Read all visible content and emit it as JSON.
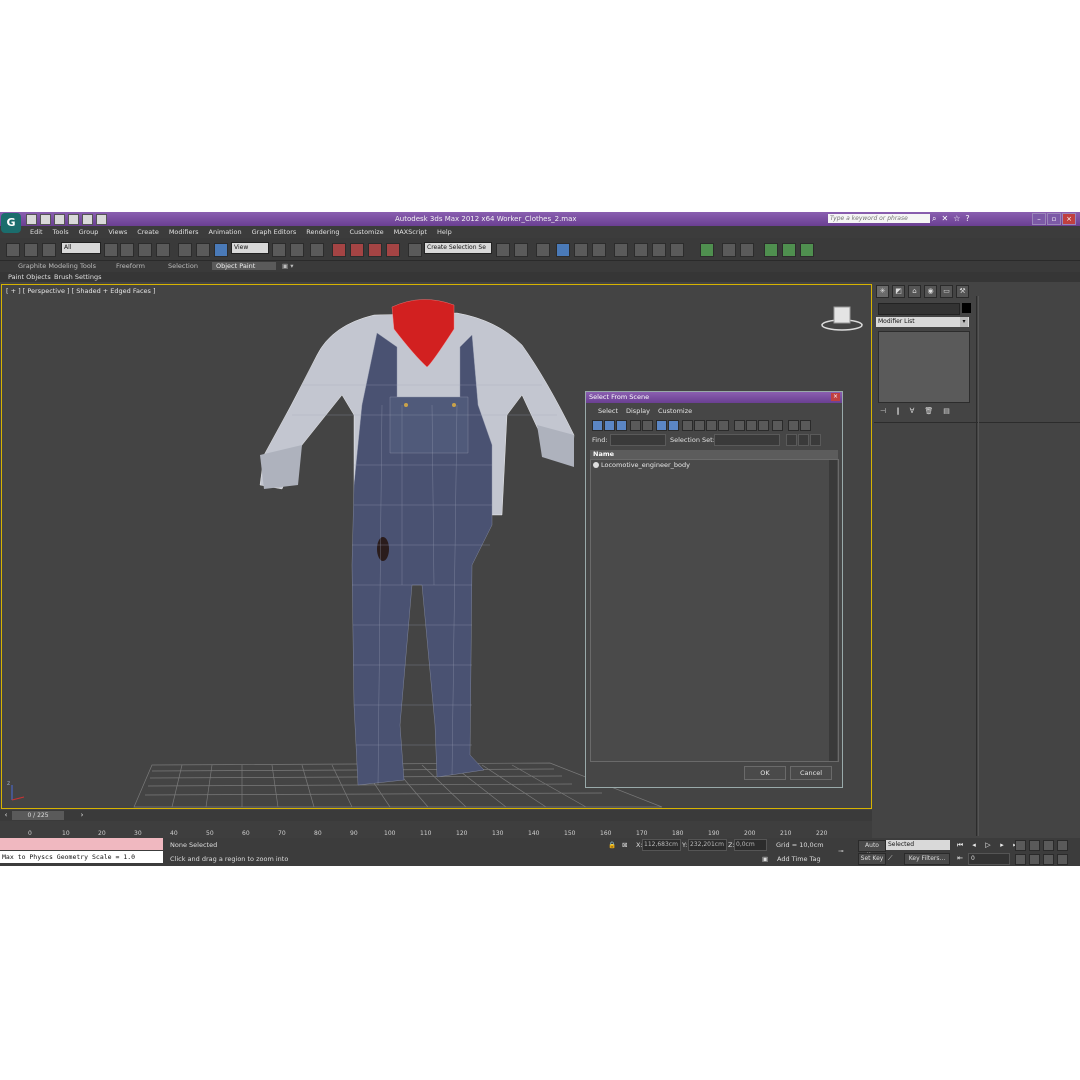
{
  "title_bar": {
    "app_title": "Autodesk 3ds Max  2012 x64     Worker_Clothes_2.max",
    "logo_text": "G",
    "search_placeholder": "Type a keyword or phrase",
    "help_icon": "?"
  },
  "menu": [
    "Edit",
    "Tools",
    "Group",
    "Views",
    "Create",
    "Modifiers",
    "Animation",
    "Graph Editors",
    "Rendering",
    "Customize",
    "MAXScript",
    "Help"
  ],
  "toolbar": {
    "filter_value": "All",
    "ref_coord_value": "View",
    "selection_set_value": "Create Selection Se"
  },
  "ribbon": {
    "tabs": [
      "Graphite Modeling Tools",
      "Freeform",
      "Selection",
      "Object Paint"
    ],
    "active_tab": "Object Paint",
    "subtabs": [
      "Paint Objects",
      "Brush Settings"
    ]
  },
  "viewport": {
    "label": "[ + ] [ Perspective ] [ Shaded + Edged Faces ]",
    "border_color": "#d6b300",
    "axis_label": "z"
  },
  "command_panel": {
    "modifier_list": "Modifier List",
    "color_swatch": "#000000"
  },
  "dialog": {
    "title": "Select From Scene",
    "menu": [
      "Select",
      "Display",
      "Customize"
    ],
    "find_label": "Find:",
    "selection_set_label": "Selection Set:",
    "column_header": "Name",
    "objects": [
      "Locomotive_engineer_body"
    ],
    "ok": "OK",
    "cancel": "Cancel"
  },
  "time_slider": {
    "position": "0 / 225",
    "ticks": [
      "0",
      "10",
      "20",
      "30",
      "40",
      "50",
      "60",
      "70",
      "80",
      "90",
      "100",
      "110",
      "120",
      "130",
      "140",
      "150",
      "160",
      "170",
      "180",
      "190",
      "200",
      "210",
      "220"
    ]
  },
  "status": {
    "maxscript_output": "Max to Physcs Geometry Scale = 1.0",
    "selection_status": "None Selected",
    "prompt": "Click and drag a region to zoom into",
    "x_value": "112,683cm",
    "y_value": "232,201cm",
    "z_value": "0,0cm",
    "grid": "Grid = 10,0cm",
    "add_time_tag": "Add Time Tag",
    "auto_key": "Auto Key",
    "set_key": "Set Key",
    "key_mode": "Selected",
    "key_filters": "Key Filters...",
    "frame_value": "0",
    "x_label": "X:",
    "y_label": "Y:",
    "z_label": "Z:"
  },
  "colors": {
    "title_purple": "#7a4ea3",
    "shirt": "#c9ccd6",
    "overalls": "#4a5272",
    "bandana": "#d22020",
    "viewport_bg": "#444444"
  }
}
